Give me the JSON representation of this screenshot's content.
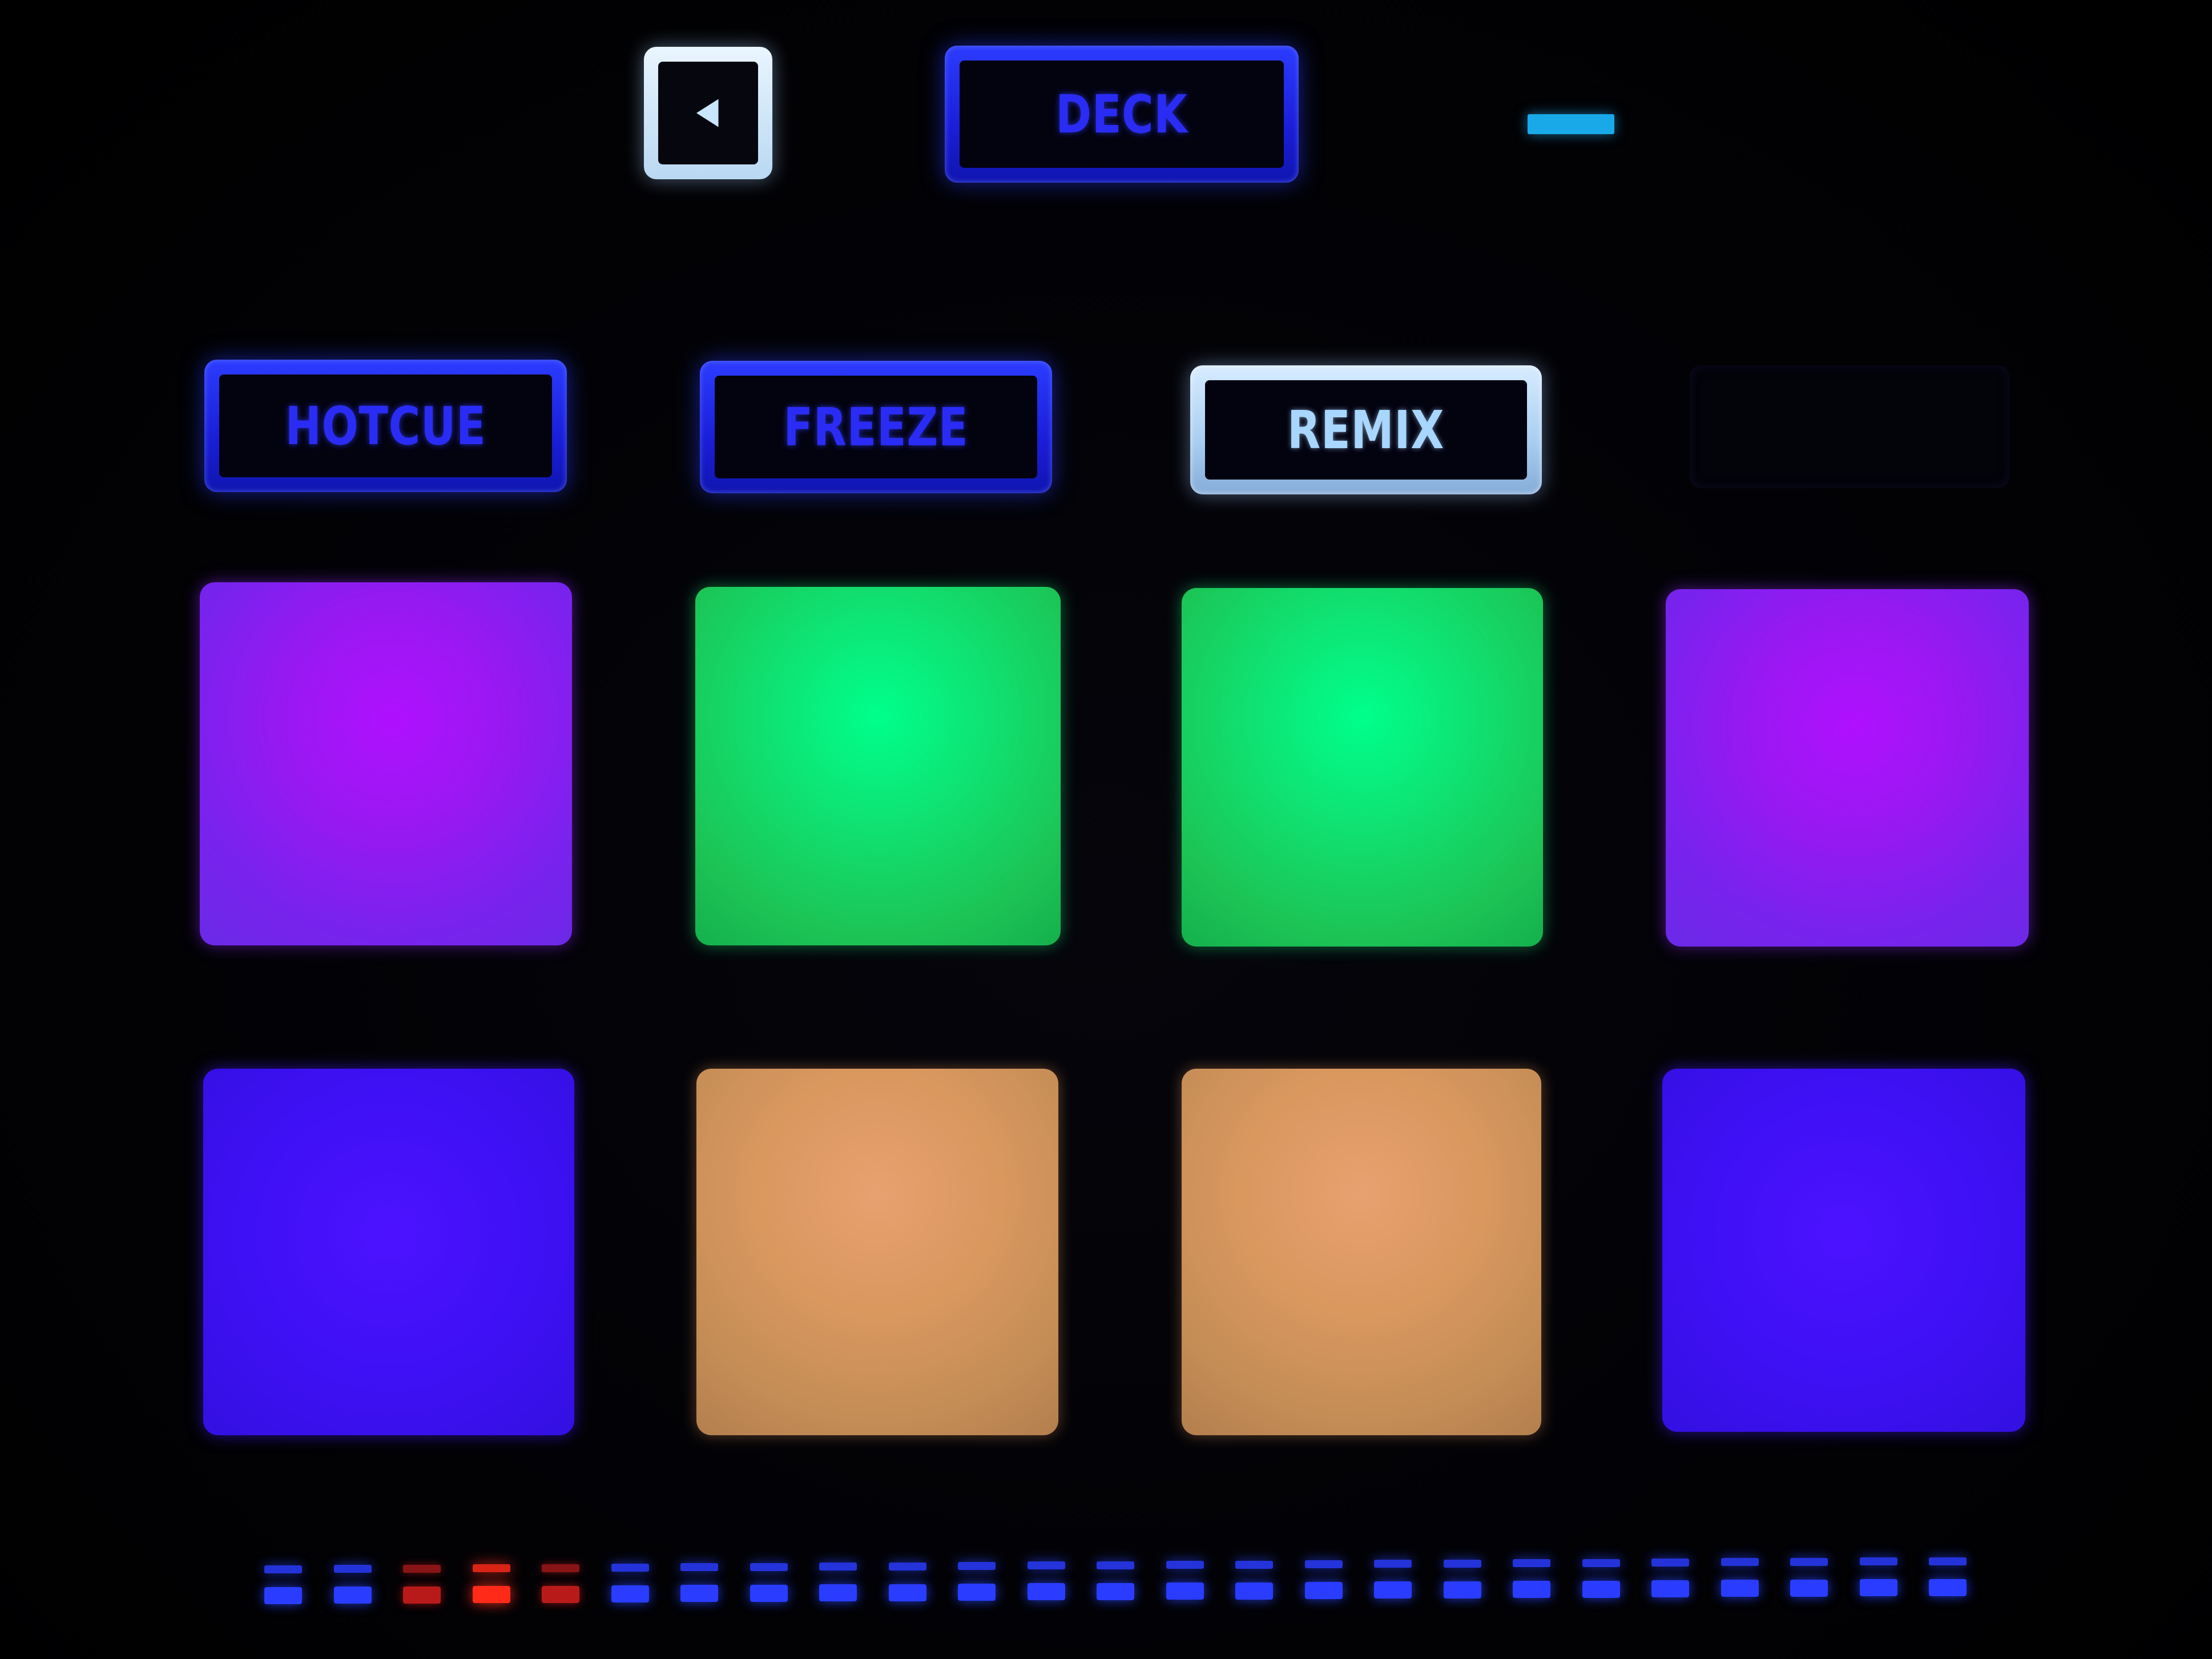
{
  "top_row": {
    "back_button_icon": "triangle-left-icon",
    "deck_label": "DECK",
    "indicator_color": "#19a8e8"
  },
  "mode_buttons": [
    {
      "label": "HOTCUE",
      "state": "blue"
    },
    {
      "label": "FREEZE",
      "state": "blue"
    },
    {
      "label": "REMIX",
      "state": "white"
    }
  ],
  "pads": {
    "row1": [
      "purple",
      "green",
      "green",
      "purple"
    ],
    "row2": [
      "blue",
      "orange",
      "orange",
      "blue"
    ]
  },
  "colors": {
    "purple": "#a514ff",
    "green": "#10e070",
    "blue": "#3e10f4",
    "orange": "#d9985e",
    "button_blue": "#2c3cff",
    "button_white": "#b9d8f2",
    "led_blue": "#2a3cff",
    "led_red": "#ff2a18"
  },
  "led_strip": {
    "colors": [
      "blue",
      "blue",
      "red",
      "red",
      "red",
      "blue",
      "blue",
      "blue",
      "blue",
      "blue",
      "blue",
      "blue",
      "blue",
      "blue",
      "blue",
      "blue",
      "blue",
      "blue",
      "blue",
      "blue",
      "blue",
      "blue",
      "blue",
      "blue",
      "blue"
    ],
    "brightest_index": 3
  }
}
